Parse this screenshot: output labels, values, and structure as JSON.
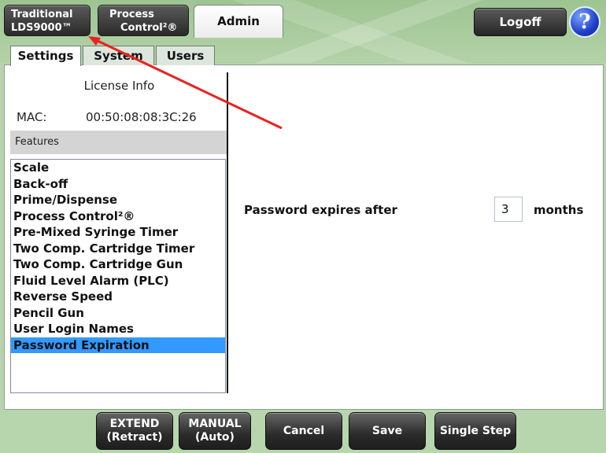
{
  "header": {
    "traditional_line1": "Traditional",
    "traditional_line2": "LDS9000™",
    "process_line1": "Process",
    "process_line2": "Control²®",
    "admin_tab": "Admin",
    "logoff": "Logoff",
    "help_glyph": "?"
  },
  "subtabs": [
    "Settings",
    "System",
    "Users"
  ],
  "license": {
    "title": "License Info",
    "mac_label": "MAC:",
    "mac_value": "00:50:08:08:3C:26"
  },
  "features": {
    "header": "Features",
    "items": [
      "Scale",
      "Back-off",
      "Prime/Dispense",
      "Process Control²®",
      "Pre-Mixed Syringe Timer",
      "Two Comp. Cartridge Timer",
      "Two Comp. Cartridge Gun",
      "Fluid Level Alarm (PLC)",
      "Reverse Speed",
      "Pencil Gun",
      "User Login Names",
      "Password Expiration"
    ],
    "selected": "Password Expiration"
  },
  "password": {
    "label": "Password expires after",
    "value": "3",
    "units": "months"
  },
  "bottom_buttons": {
    "extend_line1": "EXTEND",
    "extend_line2": "(Retract)",
    "manual_line1": "MANUAL",
    "manual_line2": "(Auto)",
    "cancel": "Cancel",
    "save": "Save",
    "single_step": "Single Step"
  },
  "colors": {
    "selection": "#3399ff",
    "annotation_arrow": "#e8231f",
    "background": "#b9d2b0"
  },
  "icons": {
    "help": "help-icon",
    "annotation": "red-arrow-annotation"
  }
}
